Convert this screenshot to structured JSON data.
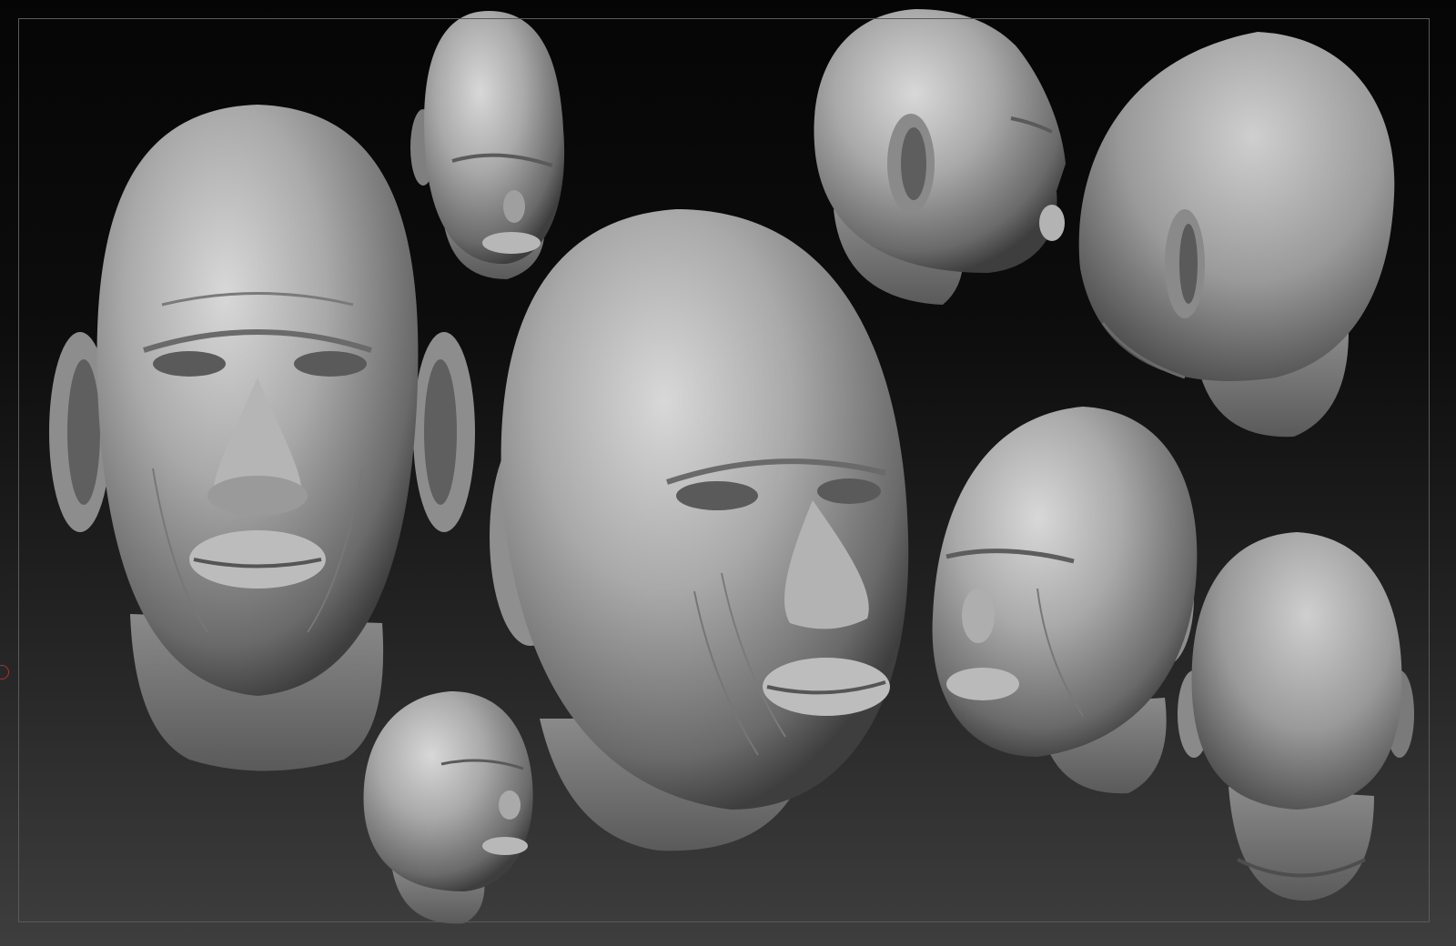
{
  "viewport": {
    "background_top": "#050505",
    "background_bottom": "#3e3e3e",
    "frame_color": "#5a5a5a",
    "hotspot_color": "#aa3333"
  },
  "sculpts": [
    {
      "id": "head-front-large",
      "view": "front"
    },
    {
      "id": "head-front-small",
      "view": "front-three-quarter"
    },
    {
      "id": "head-three-quarter-large",
      "view": "three-quarter"
    },
    {
      "id": "head-profile-right",
      "view": "profile"
    },
    {
      "id": "head-back-three-quarter",
      "view": "back-three-quarter"
    },
    {
      "id": "head-three-quarter-left",
      "view": "three-quarter-left"
    },
    {
      "id": "head-back",
      "view": "back"
    },
    {
      "id": "head-small-bottom",
      "view": "three-quarter-tilted"
    }
  ],
  "material": {
    "clay_light": "#c9c9c9",
    "clay_mid": "#8f8f8f",
    "clay_dark": "#3a3a3a"
  }
}
